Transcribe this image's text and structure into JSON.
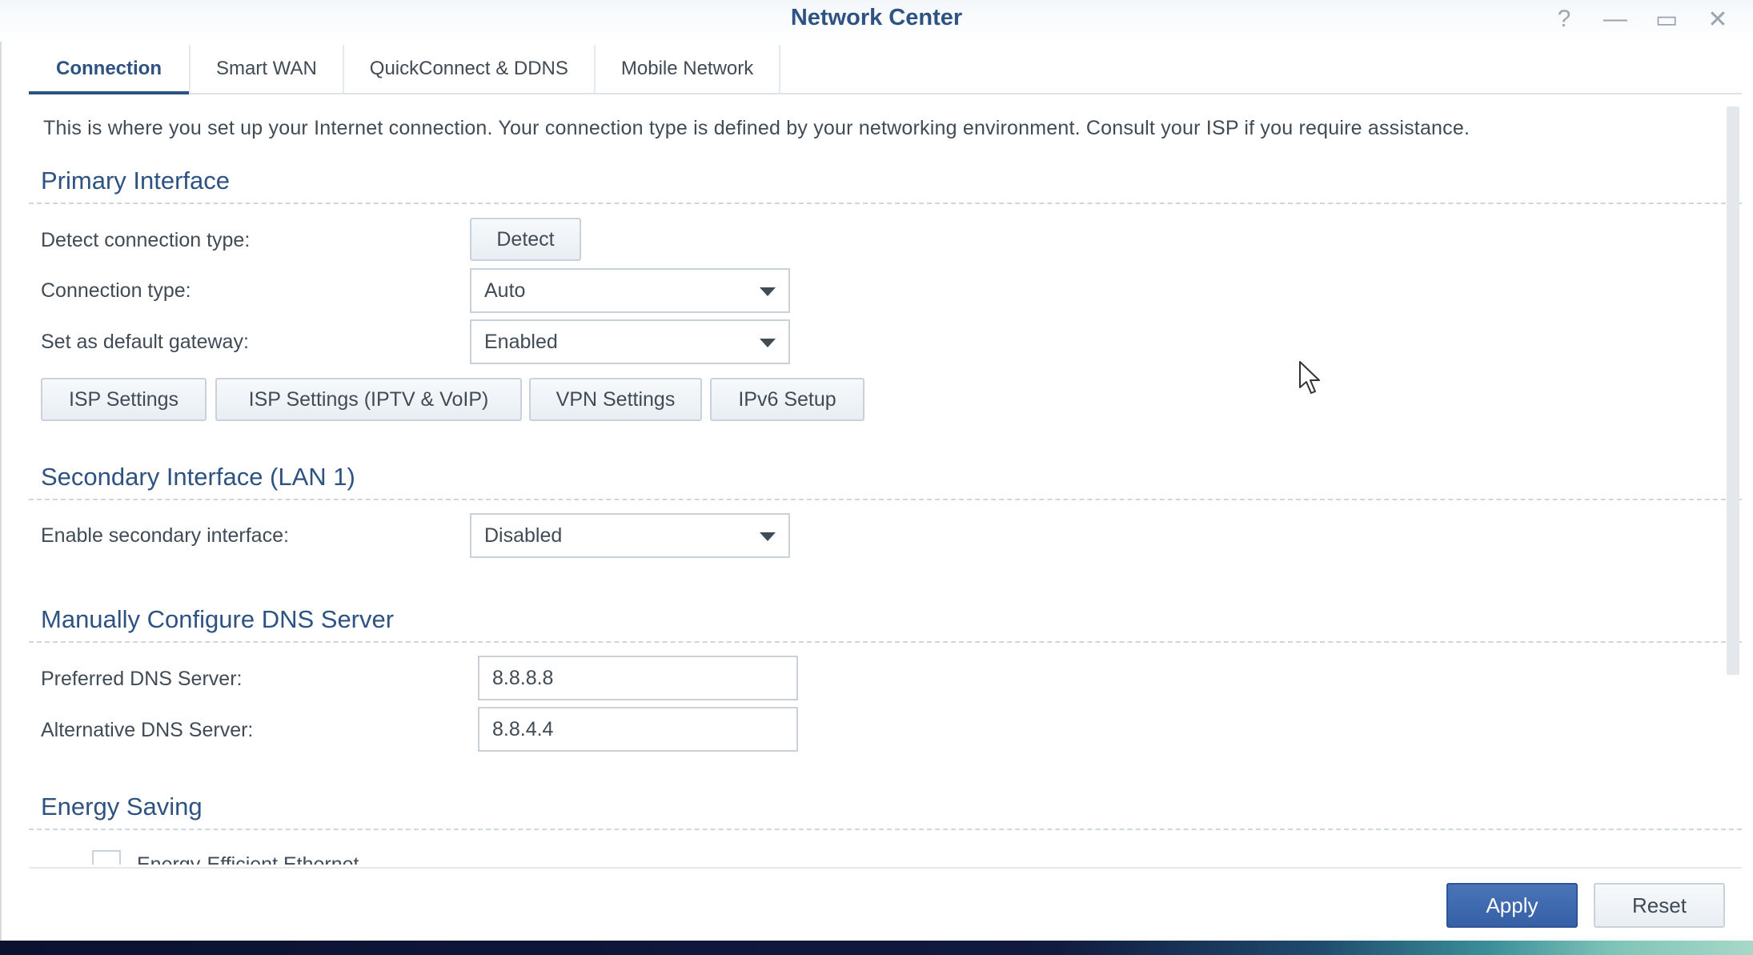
{
  "window": {
    "title": "Network Center",
    "controls": [
      {
        "name": "help-icon",
        "glyph": "?"
      },
      {
        "name": "minimize-icon",
        "glyph": "—"
      },
      {
        "name": "maximize-icon",
        "glyph": "▭"
      },
      {
        "name": "close-icon",
        "glyph": "✕"
      }
    ]
  },
  "tabs": [
    {
      "label": "Connection",
      "active": true
    },
    {
      "label": "Smart WAN",
      "active": false
    },
    {
      "label": "QuickConnect & DDNS",
      "active": false
    },
    {
      "label": "Mobile Network",
      "active": false
    }
  ],
  "intro": "This is where you set up your Internet connection. Your connection type is defined by your networking environment. Consult your ISP if you require assistance.",
  "primary": {
    "title": "Primary Interface",
    "detect_label": "Detect connection type:",
    "detect_button": "Detect",
    "conn_type_label": "Connection type:",
    "conn_type_value": "Auto",
    "gateway_label": "Set as default gateway:",
    "gateway_value": "Enabled",
    "buttons": {
      "isp": "ISP Settings",
      "isp_iptv": "ISP Settings (IPTV & VoIP)",
      "vpn": "VPN Settings",
      "ipv6": "IPv6 Setup"
    }
  },
  "secondary": {
    "title": "Secondary Interface (LAN 1)",
    "enable_label": "Enable secondary interface:",
    "enable_value": "Disabled"
  },
  "dns": {
    "title": "Manually Configure DNS Server",
    "preferred_label": "Preferred DNS Server:",
    "preferred_value": "8.8.8.8",
    "alternative_label": "Alternative DNS Server:",
    "alternative_value": "8.8.4.4"
  },
  "energy": {
    "title": "Energy Saving",
    "eee_label": "Energy-Efficient Ethernet"
  },
  "footer": {
    "apply": "Apply",
    "reset": "Reset"
  },
  "colors": {
    "accent": "#2e5383",
    "primary_button": "#3d67ad",
    "text": "#414b55"
  }
}
